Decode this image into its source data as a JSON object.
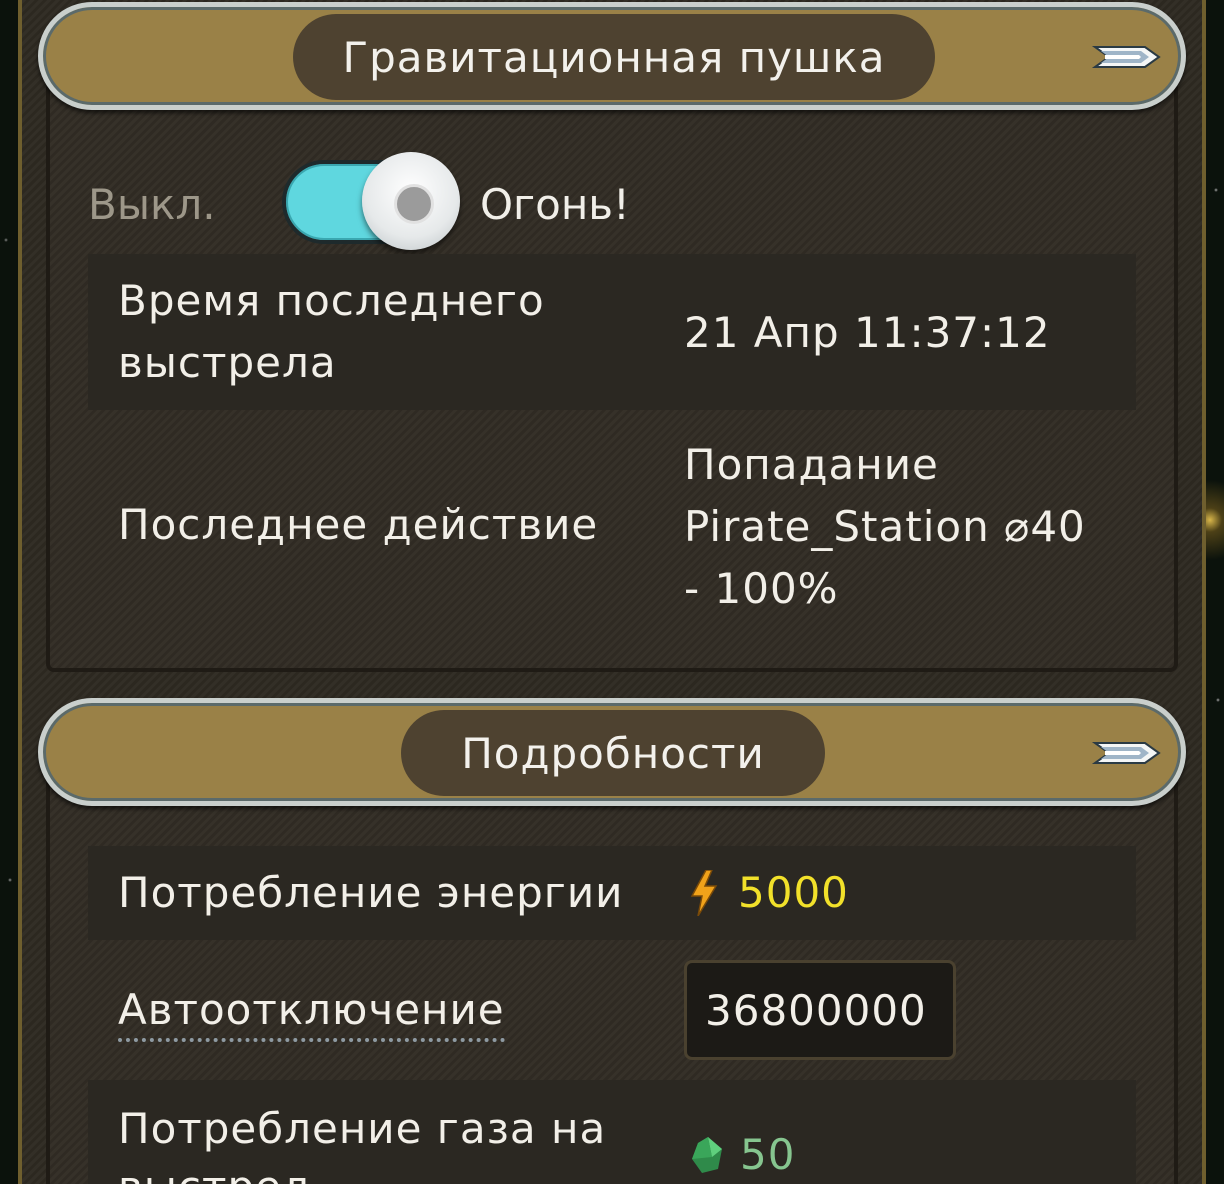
{
  "section1": {
    "title": "Гравитационная пушка",
    "toggle": {
      "off_label": "Выкл.",
      "on_label": "Огонь!",
      "state": "on"
    },
    "rows": [
      {
        "label": "Время последнего выстрела",
        "value": "21 Апр 11:37:12"
      },
      {
        "label": "Последнее действие",
        "value": "Попадание Pirate_Station ⌀40 - 100%"
      }
    ]
  },
  "section2": {
    "title": "Подробности",
    "energy": {
      "label": "Потребление энергии",
      "value": "5000",
      "icon": "lightning-icon",
      "color": "#f2e12a"
    },
    "auto_off": {
      "label": "Автоотключение",
      "value": "36800000"
    },
    "gas": {
      "label": "Потребление газа на выстрел",
      "value": "50",
      "icon": "gas-crystal-icon",
      "color": "#86c58f"
    }
  },
  "colors": {
    "header_gold": "#9a8147",
    "pill_brown": "#4e4230",
    "toggle_cyan": "#5fd7df",
    "panel_bg": "#322d25"
  }
}
